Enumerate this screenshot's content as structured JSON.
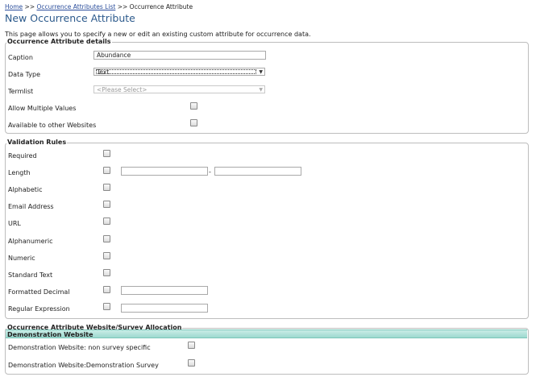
{
  "breadcrumb": {
    "home": "Home",
    "sep1": ">>",
    "list": "Occurrence Attributes List",
    "sep2": ">>",
    "current": "Occurrence Attribute"
  },
  "page_title": "New Occurrence Attribute",
  "intro": "This page allows you to specify a new or edit an existing custom attribute for occurrence data.",
  "details": {
    "legend": "Occurrence Attribute details",
    "caption_label": "Caption",
    "caption_value": "Abundance",
    "data_type_label": "Data Type",
    "data_type_value": "Text",
    "termlist_label": "Termlist",
    "termlist_value": "<Please Select>",
    "allow_multiple_label": "Allow Multiple Values",
    "available_label": "Available to other Websites"
  },
  "validation": {
    "legend": "Validation Rules",
    "required": "Required",
    "length": "Length",
    "length_sep": "-",
    "alphabetic": "Alphabetic",
    "email": "Email Address",
    "url": "URL",
    "alphanumeric": "Alphanumeric",
    "numeric": "Numeric",
    "standard_text": "Standard Text",
    "formatted_decimal": "Formatted Decimal",
    "regex": "Regular Expression"
  },
  "allocation": {
    "legend": "Occurrence Attribute Website/Survey Allocation",
    "website_header": "Demonstration Website",
    "row1": "Demonstration Website: non survey specific",
    "row2": "Demonstration Website:Demonstration Survey"
  },
  "icons": {
    "select_arrow": "dropdown-arrow-icon"
  },
  "colors": {
    "title": "#2c5a8c",
    "link": "#2a4d9b",
    "banner": "#b3e3db"
  }
}
